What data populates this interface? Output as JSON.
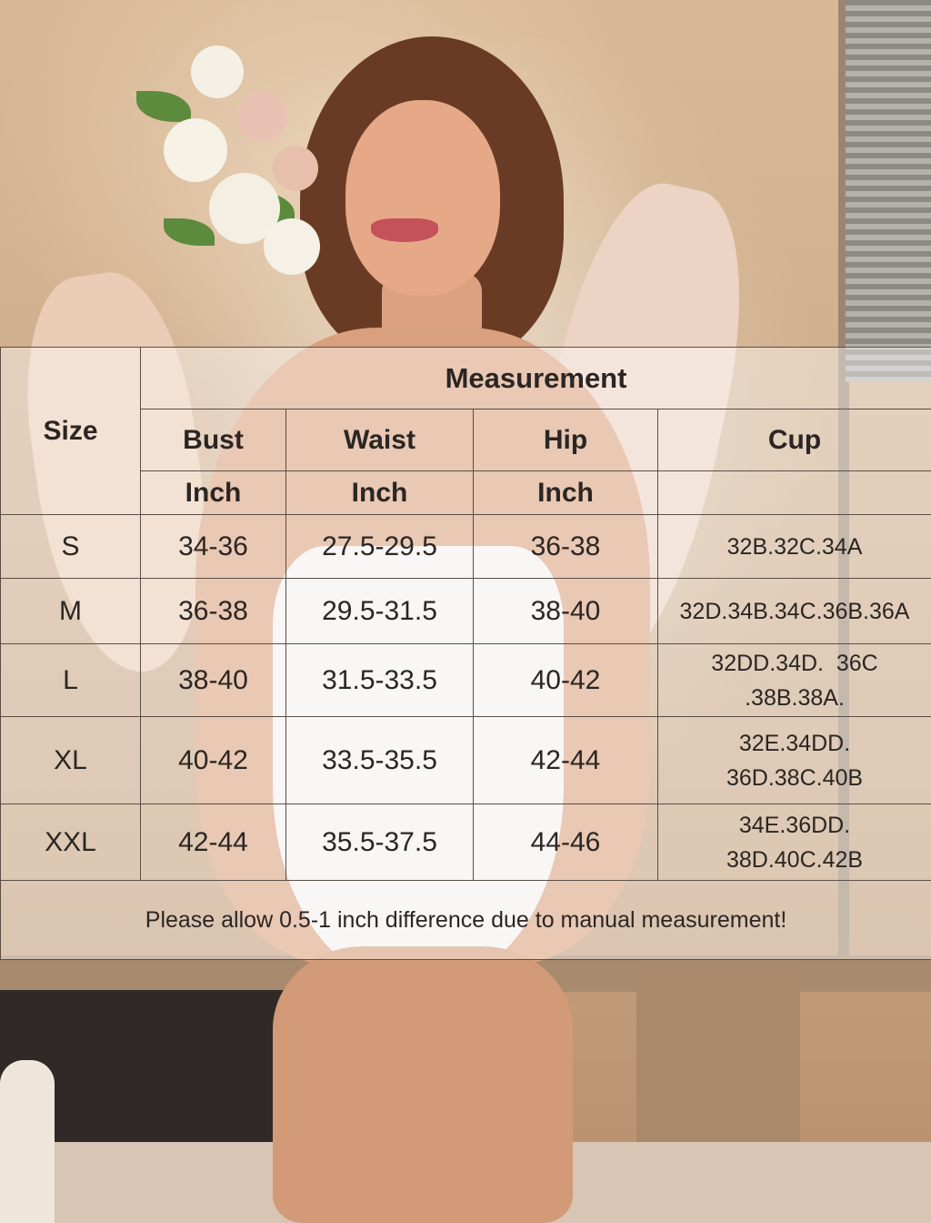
{
  "size_chart": {
    "size_header": "Size",
    "measurement_header": "Measurement",
    "columns": [
      "Bust",
      "Waist",
      "Hip",
      "Cup"
    ],
    "units": [
      "Inch",
      "Inch",
      "Inch",
      ""
    ],
    "rows": [
      {
        "size": "S",
        "bust": "34-36",
        "waist": "27.5-29.5",
        "hip": "36-38",
        "cup": [
          "32B.32C.34A"
        ]
      },
      {
        "size": "M",
        "bust": "36-38",
        "waist": "29.5-31.5",
        "hip": "38-40",
        "cup": [
          "32D.34B.34C.36B.36A"
        ]
      },
      {
        "size": "L",
        "bust": "38-40",
        "waist": "31.5-33.5",
        "hip": "40-42",
        "cup": [
          "32DD.34D.  36C",
          ".38B.38A."
        ]
      },
      {
        "size": "XL",
        "bust": "40-42",
        "waist": "33.5-35.5",
        "hip": "42-44",
        "cup": [
          "32E.34DD.",
          "36D.38C.40B"
        ]
      },
      {
        "size": "XXL",
        "bust": "42-44",
        "waist": "35.5-37.5",
        "hip": "44-46",
        "cup": [
          "34E.36DD.",
          "38D.40C.42B"
        ]
      }
    ],
    "note": "Please allow 0.5-1 inch difference due to manual measurement!"
  },
  "colors": {
    "grid_line": "#5a4e47",
    "text": "#2b2623",
    "overlay": "rgba(255,255,255,0.42)"
  }
}
